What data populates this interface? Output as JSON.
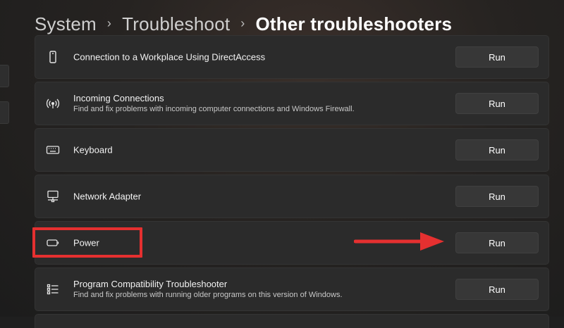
{
  "breadcrumb": {
    "items": [
      "System",
      "Troubleshoot",
      "Other troubleshooters"
    ],
    "separator": "›"
  },
  "rows": [
    {
      "icon": "phone-icon",
      "title": "Connection to a Workplace Using DirectAccess",
      "desc": "",
      "button": "Run"
    },
    {
      "icon": "wireless-signal-icon",
      "title": "Incoming Connections",
      "desc": "Find and fix problems with incoming computer connections and Windows Firewall.",
      "button": "Run"
    },
    {
      "icon": "keyboard-icon",
      "title": "Keyboard",
      "desc": "",
      "button": "Run"
    },
    {
      "icon": "network-adapter-icon",
      "title": "Network Adapter",
      "desc": "",
      "button": "Run"
    },
    {
      "icon": "battery-icon",
      "title": "Power",
      "desc": "",
      "button": "Run"
    },
    {
      "icon": "list-icon",
      "title": "Program Compatibility Troubleshooter",
      "desc": "Find and fix problems with running older programs on this version of Windows.",
      "button": "Run"
    }
  ],
  "annotation_color": "#e53030",
  "accent_bg": "#2b2b2b"
}
